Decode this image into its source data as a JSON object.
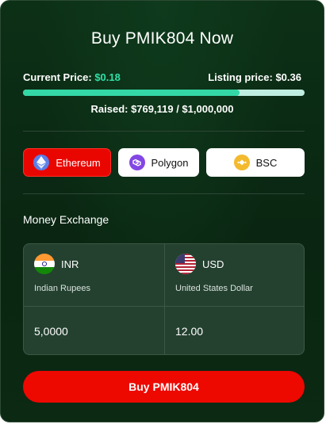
{
  "widget": {
    "title": "Buy PMIK804 Now",
    "current_price_label": "Current Price:",
    "current_price_value": "$0.18",
    "listing_price_label": "Listing price:",
    "listing_price_value": "$0.36",
    "progress_fraction": 0.769,
    "raised_text": "Raised: $769,119 / $1,000,000",
    "accent_color": "#2fe0a8"
  },
  "networks": [
    {
      "label": "Ethereum",
      "icon": "ethereum-icon",
      "selected": true
    },
    {
      "label": "Polygon",
      "icon": "polygon-icon",
      "selected": false
    },
    {
      "label": "BSC",
      "icon": "bnb-icon",
      "selected": false
    }
  ],
  "exchange": {
    "title": "Money Exchange",
    "from": {
      "code": "INR",
      "name": "Indian Rupees",
      "amount": "5,0000",
      "icon": "india-flag-icon"
    },
    "to": {
      "code": "USD",
      "name": "United States Dollar",
      "amount": "12.00",
      "icon": "us-flag-icon"
    }
  },
  "buy_button_label": "Buy PMIK804",
  "colors": {
    "primary_red": "#ed0800",
    "card_green": "#0a2612"
  }
}
